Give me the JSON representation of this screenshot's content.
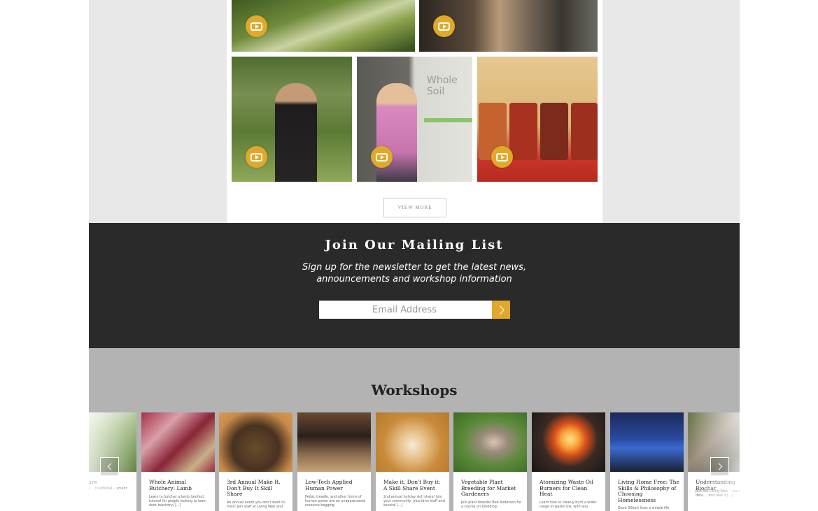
{
  "gallery": {
    "view_more_label": "VIEW MORE",
    "whole_soil_text": "Whole Soil",
    "play_icon": "youtube-play-icon"
  },
  "mailing": {
    "title": "Join Our Mailing List",
    "subtitle_line1": "Sign up for the newsletter to get the latest news,",
    "subtitle_line2": "announcements and workshop information",
    "email_placeholder": "Email Address",
    "accent_color": "#e0a92a"
  },
  "workshops": {
    "title": "Workshops",
    "cards": [
      {
        "title": "Wild Care",
        "desc": "...niques for ...traditional ...sment [...]"
      },
      {
        "title": "Whole Animal Butchery: Lamb",
        "desc": "Learn to butcher a lamb (perfect tutorial for people looking to learn deer butchery) [...]"
      },
      {
        "title": "3rd Annual Make It, Don't Buy It Skill Share",
        "desc": "An annual event you don't want to miss! Join staff at Living Web and"
      },
      {
        "title": "Low-Tech Applied Human Power",
        "desc": "Pedal, treadle, and other forms of human power are an unappreciated resource begging"
      },
      {
        "title": "Make it, Don't Buy it: A Skill Share Event",
        "desc": "2nd annual holiday skill share! Join your community, plus farm staff and several [...]"
      },
      {
        "title": "Vegetable Plant Breeding for Market Gardeners",
        "desc": "Join plant breeder Bob Andersen for a course on breeding"
      },
      {
        "title": "Atomizing Waste Oil Burners for Clean Heat",
        "desc": "Learn how to cleanly burn a wider range of waste oils, with less"
      },
      {
        "title": "Living Home Free: The Skills & Philosophy of Choosing Homelessness",
        "desc": "Dave Gilbert lives a simple life"
      },
      {
        "title": "Understanding Biochar",
        "desc": "Join the Living Web ... we discuss in deta ... and how it [...]"
      }
    ]
  }
}
